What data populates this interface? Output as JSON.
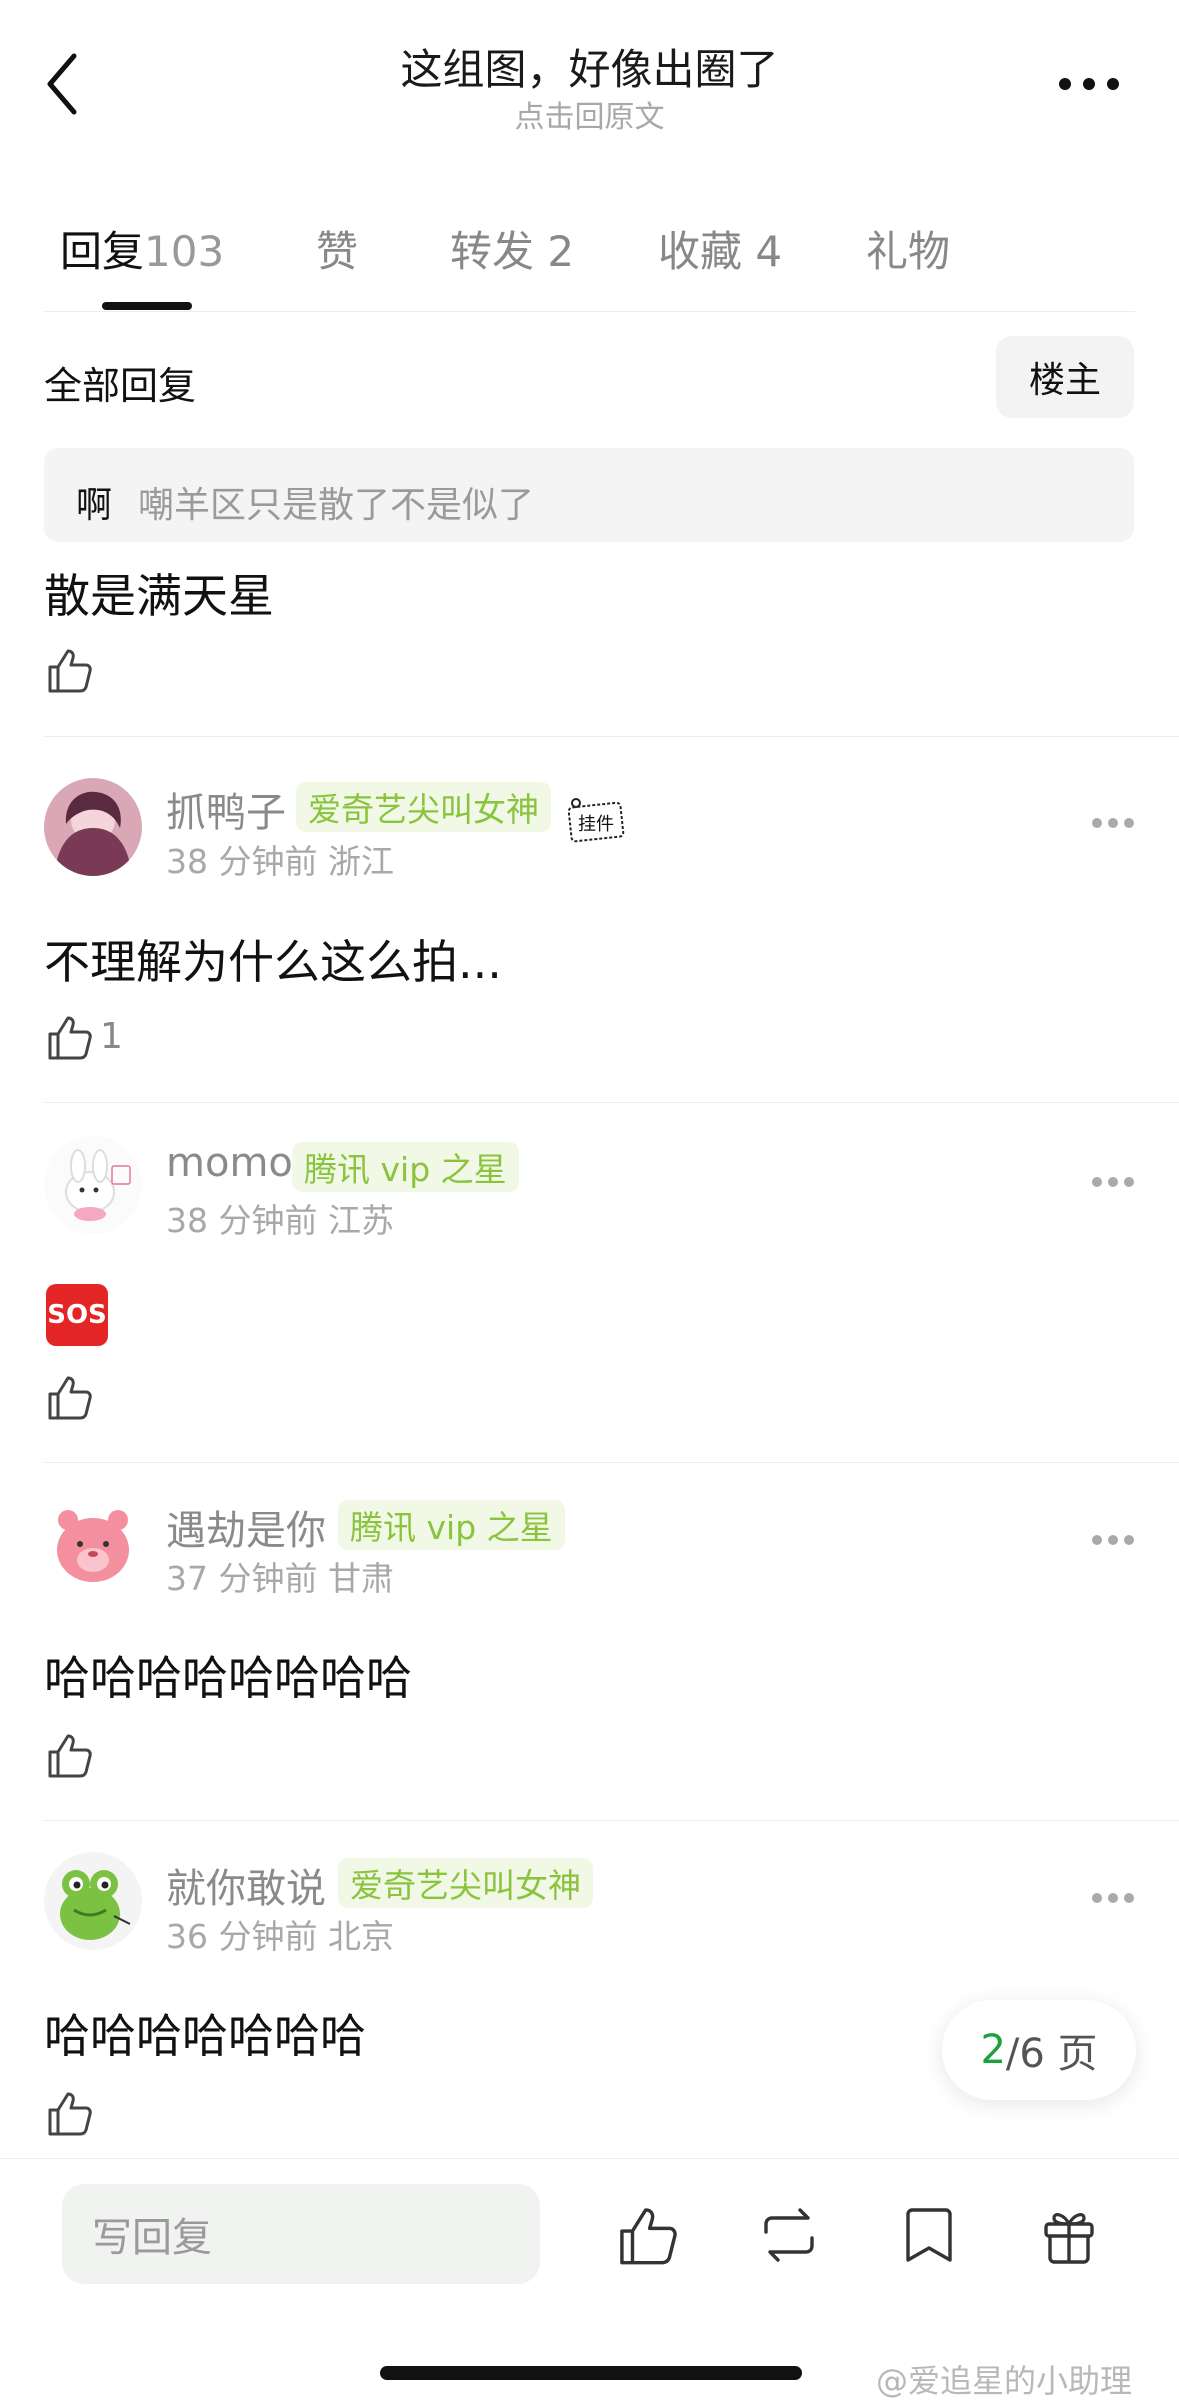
{
  "header": {
    "title": "这组图，好像出圈了",
    "subtitle": "点击回原文"
  },
  "tabs": [
    {
      "label": "回复",
      "count": "103",
      "active": true
    },
    {
      "label": "赞",
      "count": "",
      "active": false
    },
    {
      "label": "转发",
      "count": "2",
      "active": false
    },
    {
      "label": "收藏",
      "count": "4",
      "active": false
    },
    {
      "label": "礼物",
      "count": "",
      "active": false
    }
  ],
  "section": {
    "title": "全部回复",
    "louzhu_button": "楼主"
  },
  "first_reply": {
    "quote_user": "啊",
    "quote_text": "嘲羊区只是散了不是似了",
    "text": "散是满天星"
  },
  "comments": [
    {
      "username": "抓鸭子",
      "badge": "爱奇艺尖叫女神",
      "pendant": "挂件",
      "meta": "38 分钟前 浙江",
      "text": "不理解为什么这么拍...",
      "likes": "1"
    },
    {
      "username": "momo",
      "badge": "腾讯 vip 之星",
      "meta": "38 分钟前 江苏",
      "text": "SOS",
      "likes": ""
    },
    {
      "username": "遇劫是你",
      "badge": "腾讯 vip 之星",
      "meta": "37 分钟前 甘肃",
      "text": "哈哈哈哈哈哈哈哈",
      "likes": ""
    },
    {
      "username": "就你敢说",
      "badge": "爱奇艺尖叫女神",
      "meta": "36 分钟前 北京",
      "text": "哈哈哈哈哈哈哈",
      "likes": ""
    }
  ],
  "pagination": {
    "current": "2",
    "rest": "/6 页"
  },
  "bottom_bar": {
    "reply_placeholder": "写回复"
  },
  "watermark": "@爱追星的小助理",
  "colors": {
    "accent_green": "#1aa33b",
    "badge_text": "#8ac43f",
    "badge_bg": "#f1f8e6"
  }
}
